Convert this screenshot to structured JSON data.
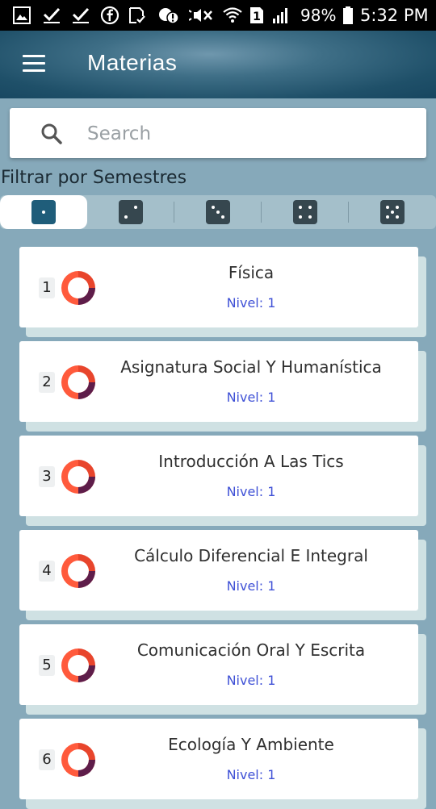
{
  "status_bar": {
    "battery": "98%",
    "time": "5:32 PM",
    "sim": "1",
    "icons": [
      "gallery-icon",
      "check-icon",
      "check-icon",
      "facebook-icon",
      "save-icon",
      "tool-alert-icon",
      "mute-icon",
      "wifi-icon",
      "sim-icon",
      "signal-icon",
      "battery-icon"
    ]
  },
  "appbar": {
    "title": "Materias",
    "menu_icon": "hamburger-menu-icon"
  },
  "search": {
    "placeholder": "Search",
    "value": ""
  },
  "filter": {
    "label": "Filtrar por Semestres",
    "segments": [
      {
        "die": 1,
        "active": true
      },
      {
        "die": 2,
        "active": false
      },
      {
        "die": 3,
        "active": false
      },
      {
        "die": 4,
        "active": false
      },
      {
        "die": 5,
        "active": false
      }
    ]
  },
  "subjects": [
    {
      "number": "1",
      "name": "Física",
      "level_label": "Nivel:",
      "level": "1"
    },
    {
      "number": "2",
      "name": "Asignatura Social Y Humanística",
      "level_label": "Nivel:",
      "level": "1"
    },
    {
      "number": "3",
      "name": "Introducción A Las Tics",
      "level_label": "Nivel:",
      "level": "1"
    },
    {
      "number": "4",
      "name": "Cálculo Diferencial E Integral",
      "level_label": "Nivel:",
      "level": "1"
    },
    {
      "number": "5",
      "name": "Comunicación Oral Y Escrita",
      "level_label": "Nivel:",
      "level": "1"
    },
    {
      "number": "6",
      "name": "Ecología Y Ambiente",
      "level_label": "Nivel:",
      "level": "1"
    }
  ],
  "colors": {
    "appbar_dark": "#174660",
    "background": "#86a9ba",
    "level_text": "#3f51d6",
    "donut_light": "#ff5a3c",
    "donut_dark": "#5e1d4a"
  }
}
